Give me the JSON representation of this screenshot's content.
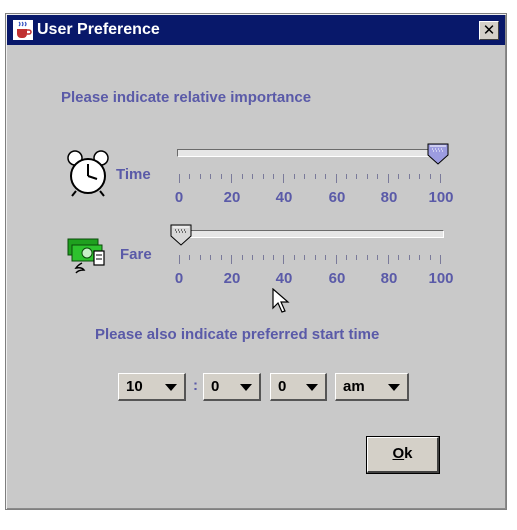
{
  "window": {
    "title": "User Preference",
    "close_label": "✕"
  },
  "importance_label": "Please indicate relative importance",
  "time_slider": {
    "label": "Time",
    "value": 100,
    "min": 0,
    "max": 100,
    "tick_labels": [
      "0",
      "20",
      "40",
      "60",
      "80",
      "100"
    ]
  },
  "fare_slider": {
    "label": "Fare",
    "value": 0,
    "min": 0,
    "max": 100,
    "tick_labels": [
      "0",
      "20",
      "40",
      "60",
      "80",
      "100"
    ]
  },
  "start_time_label": "Please also indicate preferred start time",
  "start_time": {
    "hour": "10",
    "separator": ":",
    "minute_tens": "0",
    "minute_ones": "0",
    "ampm": "am"
  },
  "ok_label": "k",
  "ok_mnemonic": "O",
  "colors": {
    "title_bar": "#08186a",
    "label": "#5a5aa8",
    "thumb": "#9c9ce0",
    "window_bg": "#c9c9c9"
  },
  "icons": {
    "title": "java-cup-icon",
    "time": "alarm-clock-icon",
    "fare": "money-icon"
  }
}
